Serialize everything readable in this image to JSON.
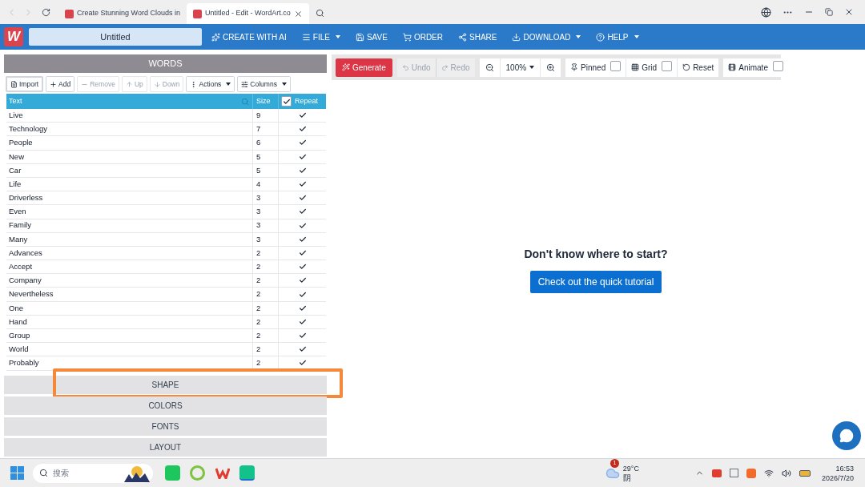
{
  "browser": {
    "tabs": [
      {
        "title": "Create Stunning Word Clouds in",
        "selected": false
      },
      {
        "title": "Untitled - Edit - WordArt.co",
        "selected": true
      }
    ]
  },
  "app": {
    "logo": "W",
    "title": "Untitled",
    "menu": [
      {
        "kind": "ai",
        "label": "CREATE WITH AI",
        "dropdown": false
      },
      {
        "kind": "file",
        "label": "FILE",
        "dropdown": true
      },
      {
        "kind": "save",
        "label": "SAVE",
        "dropdown": false
      },
      {
        "kind": "order",
        "label": "ORDER",
        "dropdown": false
      },
      {
        "kind": "share",
        "label": "SHARE",
        "dropdown": false
      },
      {
        "kind": "download",
        "label": "DOWNLOAD",
        "dropdown": true
      },
      {
        "kind": "help",
        "label": "HELP",
        "dropdown": true
      }
    ]
  },
  "words": {
    "title": "WORDS",
    "toolbar": [
      {
        "kind": "import",
        "label": "Import",
        "disabled": false,
        "dropdown": false
      },
      {
        "kind": "add",
        "label": "Add",
        "disabled": false,
        "dropdown": false
      },
      {
        "kind": "remove",
        "label": "Remove",
        "disabled": true,
        "dropdown": false
      },
      {
        "kind": "up",
        "label": "Up",
        "disabled": true,
        "dropdown": false
      },
      {
        "kind": "down",
        "label": "Down",
        "disabled": true,
        "dropdown": false
      },
      {
        "kind": "actions",
        "label": "Actions",
        "disabled": false,
        "dropdown": true
      },
      {
        "kind": "columns",
        "label": "Columns",
        "disabled": false,
        "dropdown": true
      }
    ],
    "columns": {
      "text": "Text",
      "size": "Size",
      "repeat": "Repeat",
      "repeat_all": true
    },
    "rows": [
      {
        "text": "Live",
        "size": "9",
        "repeat": true
      },
      {
        "text": "Technology",
        "size": "7",
        "repeat": true
      },
      {
        "text": "People",
        "size": "6",
        "repeat": true
      },
      {
        "text": "New",
        "size": "5",
        "repeat": true
      },
      {
        "text": "Car",
        "size": "5",
        "repeat": true
      },
      {
        "text": "Life",
        "size": "4",
        "repeat": true
      },
      {
        "text": "Driverless",
        "size": "3",
        "repeat": true
      },
      {
        "text": "Even",
        "size": "3",
        "repeat": true
      },
      {
        "text": "Family",
        "size": "3",
        "repeat": true
      },
      {
        "text": "Many",
        "size": "3",
        "repeat": true
      },
      {
        "text": "Advances",
        "size": "2",
        "repeat": true
      },
      {
        "text": "Accept",
        "size": "2",
        "repeat": true
      },
      {
        "text": "Company",
        "size": "2",
        "repeat": true
      },
      {
        "text": "Nevertheless",
        "size": "2",
        "repeat": true
      },
      {
        "text": "One",
        "size": "2",
        "repeat": true
      },
      {
        "text": "Hand",
        "size": "2",
        "repeat": true
      },
      {
        "text": "Group",
        "size": "2",
        "repeat": true
      },
      {
        "text": "World",
        "size": "2",
        "repeat": true
      },
      {
        "text": "Probably",
        "size": "2",
        "repeat": true
      }
    ]
  },
  "sections": [
    {
      "label": "SHAPE",
      "highlighted": true
    },
    {
      "label": "COLORS",
      "highlighted": false
    },
    {
      "label": "FONTS",
      "highlighted": false
    },
    {
      "label": "LAYOUT",
      "highlighted": false
    }
  ],
  "canvas_toolbar": {
    "generate": "Generate",
    "undo": "Undo",
    "redo": "Redo",
    "zoom": "100%",
    "options": [
      {
        "kind": "pin",
        "label": "Pinned",
        "checked": false
      },
      {
        "kind": "grid",
        "label": "Grid",
        "checked": false
      }
    ],
    "reset": "Reset",
    "animate": {
      "label": "Animate",
      "checked": false
    }
  },
  "canvas": {
    "prompt": "Don't know where to start?",
    "tutorial_button": "Check out the quick tutorial"
  },
  "taskbar": {
    "search_placeholder": "搜索",
    "weather": {
      "badge": "1",
      "temp": "29°C",
      "condition": "阴"
    },
    "time": "16:53",
    "date": "2026/7/20"
  }
}
